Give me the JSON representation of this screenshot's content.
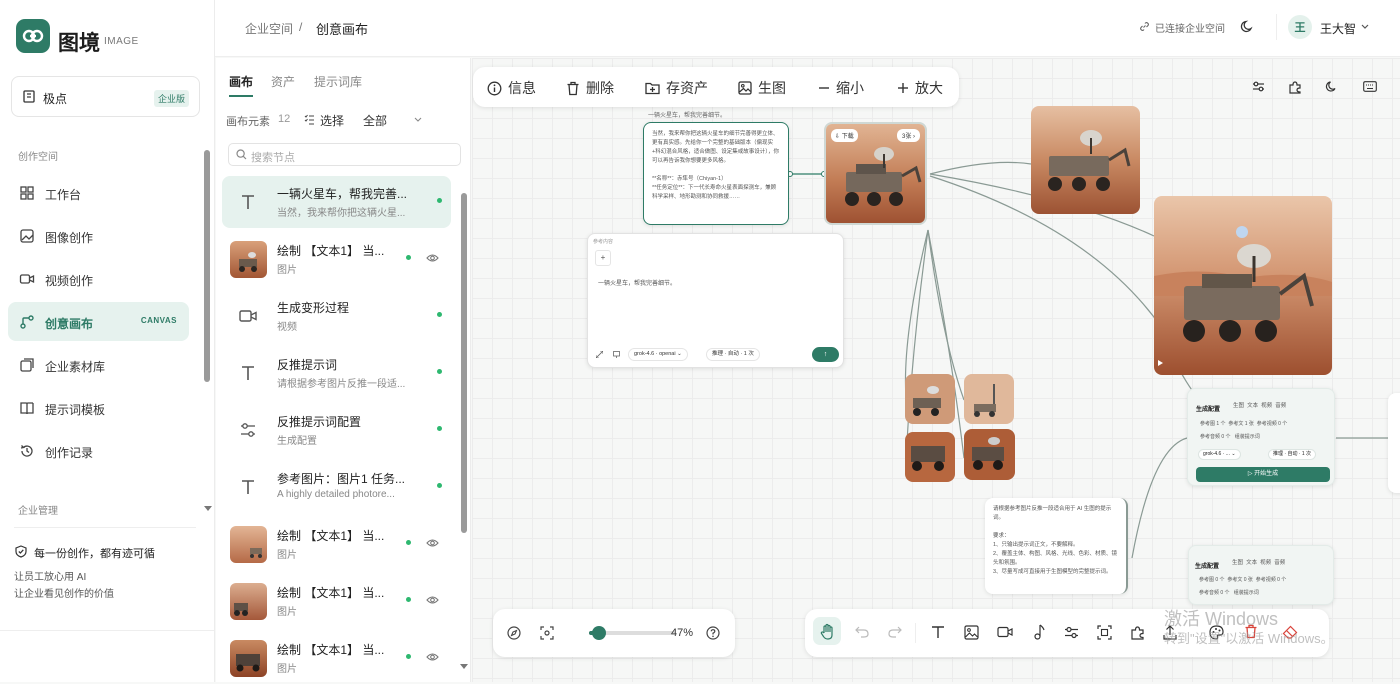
{
  "app": {
    "name": "图境",
    "name_sub": "IMAGE"
  },
  "workspace": {
    "name": "极点",
    "badge": "企业版"
  },
  "sidebar": {
    "section_create": "创作空间",
    "items": [
      {
        "label": "工作台",
        "icon": "dashboard-icon"
      },
      {
        "label": "图像创作",
        "icon": "image-edit-icon"
      },
      {
        "label": "视频创作",
        "icon": "video-icon"
      },
      {
        "label": "创意画布",
        "icon": "canvas-flow-icon",
        "tag": "CANVAS",
        "active": true
      },
      {
        "label": "企业素材库",
        "icon": "asset-library-icon"
      },
      {
        "label": "提示词模板",
        "icon": "book-icon"
      },
      {
        "label": "创作记录",
        "icon": "history-icon"
      }
    ],
    "section_manage": "企业管理",
    "footer": {
      "line1": "每一份创作，都有迹可循",
      "line2": "让员工放心用 AI",
      "line3": "让企业看见创作的价值"
    }
  },
  "breadcrumb": {
    "root": "企业空间",
    "sep": "/",
    "current": "创意画布"
  },
  "header": {
    "connection": "已连接企业空间",
    "user_avatar": "王",
    "user_name": "王大智"
  },
  "panel": {
    "tabs": [
      "画布",
      "资产",
      "提示词库"
    ],
    "elements_label": "画布元素",
    "elements_count": "12",
    "select_label": "选择",
    "filter_value": "全部",
    "search_placeholder": "搜索节点",
    "items": [
      {
        "title": "一辆火星车，帮我完善...",
        "subtitle": "当然，我来帮你把这辆火星...",
        "type": "text"
      },
      {
        "title": "绘制 【文本1】 当...",
        "subtitle": "图片",
        "type": "image"
      },
      {
        "title": "生成变形过程",
        "subtitle": "视频",
        "type": "video"
      },
      {
        "title": "反推提示词",
        "subtitle": "请根据参考图片反推一段适...",
        "type": "text"
      },
      {
        "title": "反推提示词配置",
        "subtitle": "生成配置",
        "type": "config"
      },
      {
        "title": "参考图片：图片1 任务...",
        "subtitle": "A highly detailed photore...",
        "type": "text"
      },
      {
        "title": "绘制 【文本1】 当...",
        "subtitle": "图片",
        "type": "image"
      },
      {
        "title": "绘制 【文本1】 当...",
        "subtitle": "图片",
        "type": "image"
      },
      {
        "title": "绘制 【文本1】 当...",
        "subtitle": "图片",
        "type": "image"
      }
    ]
  },
  "canvas_toolbar": {
    "info": "信息",
    "delete": "删除",
    "save_asset": "存资产",
    "gen_image": "生图",
    "zoom_out": "缩小",
    "zoom_in": "放大"
  },
  "nodes": {
    "text_top_caption": "一辆火星车，帮我完善细节。",
    "text_node": "当然，我来帮你把这辆火星车的细节完善得更立体、更有真实感。先给你一个完整的基础版本（偏现实+科幻混合风格，适合做图、设定集或故事设计），你可以再告诉我你想要更多风格。\n\n**名称**：赤隼号（Chiyan-1）\n**任务定位**：下一代长寿命火星表面探测车，兼顾科学采样、地形勘测和协同救援……",
    "download_label": "下载",
    "img_count": "3张",
    "ref_label": "参考内容",
    "prompt_text": "一辆火星车，帮我完善细节。",
    "model_a": "grok-4.6 · openai",
    "param_a": "推理 · 自动 · 1 次",
    "gen_title": "生成配置",
    "gen_tabs": [
      "生图",
      "文本",
      "视频",
      "音频"
    ],
    "gen_row1": [
      "参考图 1 个",
      "参考文 1 张",
      "参考视频 0 个"
    ],
    "gen_row2": [
      "参考音频 0 个"
    ],
    "gen_prompt_btn": "组装提示词",
    "model_b": "grok-4.6 · ...",
    "param_b": "推理 · 自动 · 1 次",
    "start_btn": "开始生成",
    "reverse_text": "请根据参考图片反推一段适合用于 AI 生图的提示词。\n\n要求：\n1、只输出提示词正文，不要解释。\n2、覆盖主体、构图、风格、光线、色彩、材质、镜头和氛围。\n3、尽量写成可直接用于生图模型的完整提示词。",
    "gen2_title": "生成配置",
    "gen2_tabs": [
      "生图",
      "文本",
      "视频",
      "音频"
    ],
    "gen2_row1": [
      "参考图 0 个",
      "参考文 0 张",
      "参考视频 0 个"
    ],
    "gen2_row2": [
      "参考音频 0 个"
    ],
    "gen2_prompt_btn": "组装提示词"
  },
  "bottom_bar": {
    "zoom": "47%"
  },
  "watermark": {
    "line1": "激活 Windows",
    "line2": "转到\"设置\"以激活 Windows。"
  },
  "colors": {
    "accent": "#2e7b66",
    "accent_light": "#e6f2ee",
    "status_dot": "#2eb870"
  }
}
